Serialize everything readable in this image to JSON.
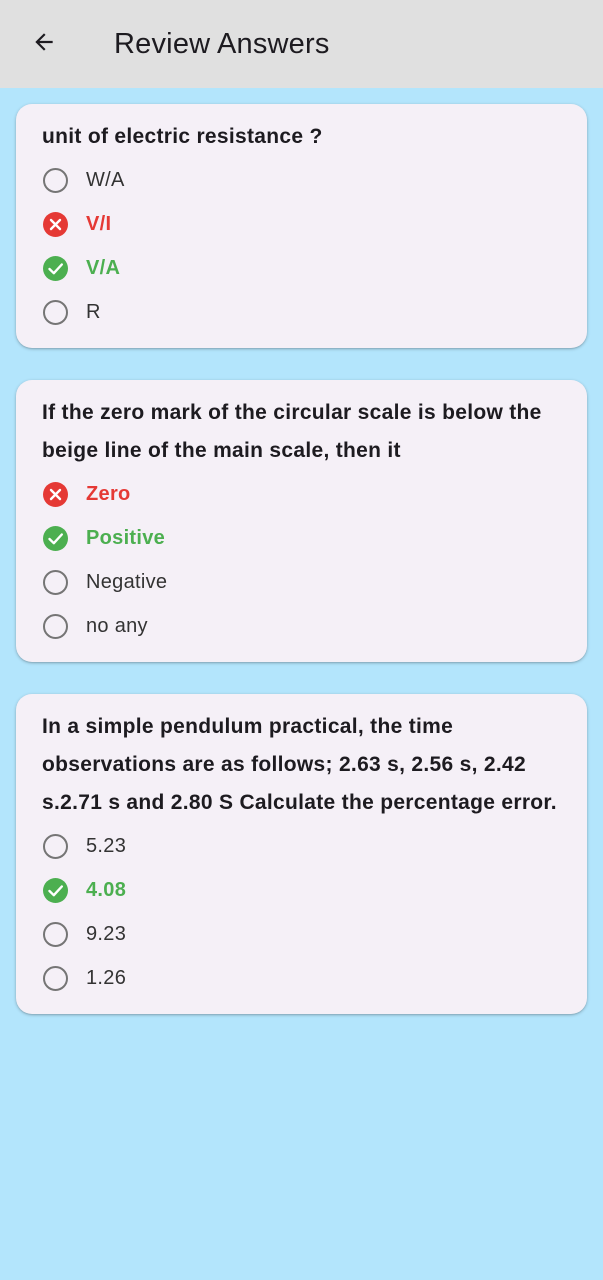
{
  "app_bar": {
    "title": "Review Answers",
    "back_icon": "arrow-left-icon"
  },
  "colors": {
    "background": "#b3e5fc",
    "app_bar": "#e0e0e0",
    "card": "#f5f0f7",
    "correct": "#4caf50",
    "wrong": "#e53935",
    "radio_border": "#757575"
  },
  "questions": [
    {
      "text": "unit of electric resistance ?",
      "options": [
        {
          "label": "W/A",
          "status": "unselected"
        },
        {
          "label": "V/I",
          "status": "wrong"
        },
        {
          "label": "V/A",
          "status": "correct"
        },
        {
          "label": "R",
          "status": "unselected"
        }
      ]
    },
    {
      "text": "If the zero mark of the circular scale is below the beige line of the main scale, then it",
      "options": [
        {
          "label": "Zero",
          "status": "wrong"
        },
        {
          "label": "Positive",
          "status": "correct"
        },
        {
          "label": "Negative",
          "status": "unselected"
        },
        {
          "label": "no any",
          "status": "unselected"
        }
      ]
    },
    {
      "text": "In a simple pendulum practical, the time observations are as follows; 2.63 s, 2.56 s, 2.42 s.2.71 s and 2.80 S Calculate the percentage error.",
      "options": [
        {
          "label": "5.23",
          "status": "unselected"
        },
        {
          "label": "4.08",
          "status": "correct"
        },
        {
          "label": "9.23",
          "status": "unselected"
        },
        {
          "label": "1.26",
          "status": "unselected"
        }
      ]
    }
  ]
}
